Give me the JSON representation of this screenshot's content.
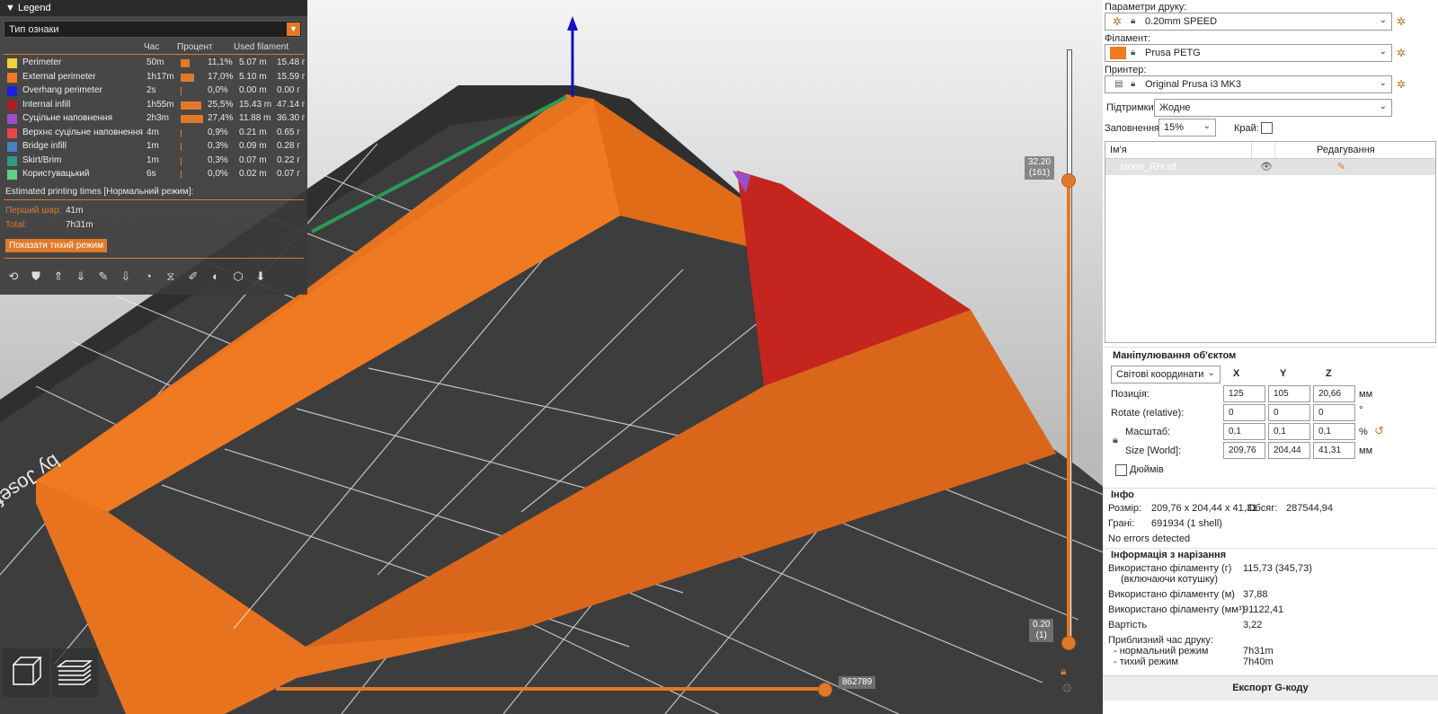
{
  "legend": {
    "title": "Legend",
    "view_type": "Тип ознаки",
    "columns": {
      "time": "Час",
      "percent": "Процент",
      "used": "Used filament"
    },
    "rows": [
      {
        "name": "Perimeter",
        "time": "50m",
        "percent": "11,1%",
        "m": "5.07 m",
        "g": "15.48 г",
        "color": "#F2D13C",
        "bar": 0.111
      },
      {
        "name": "External perimeter",
        "time": "1h17m",
        "percent": "17,0%",
        "m": "5.10 m",
        "g": "15.59 г",
        "color": "#F07B20",
        "bar": 0.17
      },
      {
        "name": "Overhang perimeter",
        "time": "2s",
        "percent": "0,0%",
        "m": "0.00 m",
        "g": "0.00 г",
        "color": "#1E1EDD",
        "bar": 0.0
      },
      {
        "name": "Internal infill",
        "time": "1h55m",
        "percent": "25,5%",
        "m": "15.43 m",
        "g": "47.14 г",
        "color": "#B01E22",
        "bar": 0.255
      },
      {
        "name": "Суцільне наповнення",
        "time": "2h3m",
        "percent": "27,4%",
        "m": "11.88 m",
        "g": "36.30 г",
        "color": "#9A4FC8",
        "bar": 0.274
      },
      {
        "name": "Верхнє суцільне наповнення",
        "time": "4m",
        "percent": "0,9%",
        "m": "0.21 m",
        "g": "0.65 г",
        "color": "#E8454A",
        "bar": 0.009
      },
      {
        "name": "Bridge infill",
        "time": "1m",
        "percent": "0,3%",
        "m": "0.09 m",
        "g": "0.28 г",
        "color": "#4A7EC4",
        "bar": 0.003
      },
      {
        "name": "Skirt/Brim",
        "time": "1m",
        "percent": "0,3%",
        "m": "0.07 m",
        "g": "0.22 г",
        "color": "#2E9A86",
        "bar": 0.003
      },
      {
        "name": "Користувацький",
        "time": "6s",
        "percent": "0,0%",
        "m": "0.02 m",
        "g": "0.07 г",
        "color": "#5ED18B",
        "bar": 0.0
      }
    ],
    "estimated_title": "Estimated printing times [Нормальний режим]:",
    "first_layer_label": "Перший шар:",
    "first_layer_value": "41m",
    "total_label": "Total:",
    "total_value": "7h31m",
    "silent_button": "Показати тихий режим"
  },
  "sliders": {
    "top_value": "32.20",
    "top_layer": "(161)",
    "bottom_value": "0.20",
    "bottom_layer": "(1)",
    "horizontal_value": "862789"
  },
  "right": {
    "print_settings_label": "Параметри друку:",
    "print_settings_value": "0.20mm SPEED",
    "filament_label": "Філамент:",
    "filament_value": "Prusa PETG",
    "filament_color": "#F07B20",
    "printer_label": "Принтер:",
    "printer_value": "Original Prusa i3 MK3",
    "supports_label": "Підтримки:",
    "supports_value": "Жодне",
    "infill_label": "Заповнення:",
    "infill_value": "15%",
    "brim_label": "Край:",
    "objects_col_name": "Ім'я",
    "objects_col_edit": "Редагування",
    "object_name": "stone_RH.stl",
    "manip_title": "Маніпулювання об'єктом",
    "coord_system": "Світові координати",
    "axis_x": "X",
    "axis_y": "Y",
    "axis_z": "Z",
    "position_label": "Позиція:",
    "position": [
      "125",
      "105",
      "20,66"
    ],
    "position_unit": "мм",
    "rotate_label": "Rotate (relative):",
    "rotate": [
      "0",
      "0",
      "0"
    ],
    "rotate_unit": "°",
    "scale_label": "Масштаб:",
    "scale": [
      "0,1",
      "0,1",
      "0,1"
    ],
    "scale_unit": "%",
    "size_label": "Size [World]:",
    "size": [
      "209,76",
      "204,44",
      "41,31"
    ],
    "size_unit": "мм",
    "inches_label": "Дюймів",
    "info_title": "Інфо",
    "info_size_label": "Розмір:",
    "info_size_value": "209,76 x 204,44 x 41,31",
    "info_volume_label": "Обсяг:",
    "info_volume_value": "287544,94",
    "info_facets_label": "Грані:",
    "info_facets_value": "691934 (1 shell)",
    "info_errors": "No errors detected",
    "slice_title": "Інформація з нарізання",
    "used_g_label": "Використано філаменту (г)",
    "used_g_sub": "(включаючи котушку)",
    "used_g_value": "115,73 (345,73)",
    "used_m_label": "Використано філаменту (м)",
    "used_m_value": "37,88",
    "used_mm3_label": "Використано філаменту (мм³)",
    "used_mm3_value": "91122,41",
    "cost_label": "Вартість",
    "cost_value": "3,22",
    "est_time_label": "Приблизний час друку:",
    "normal_mode_label": "- нормальний режим",
    "normal_mode_value": "7h31m",
    "silent_mode_label": "- тихий режим",
    "silent_mode_value": "7h40m",
    "export_button": "Експорт G-коду"
  }
}
